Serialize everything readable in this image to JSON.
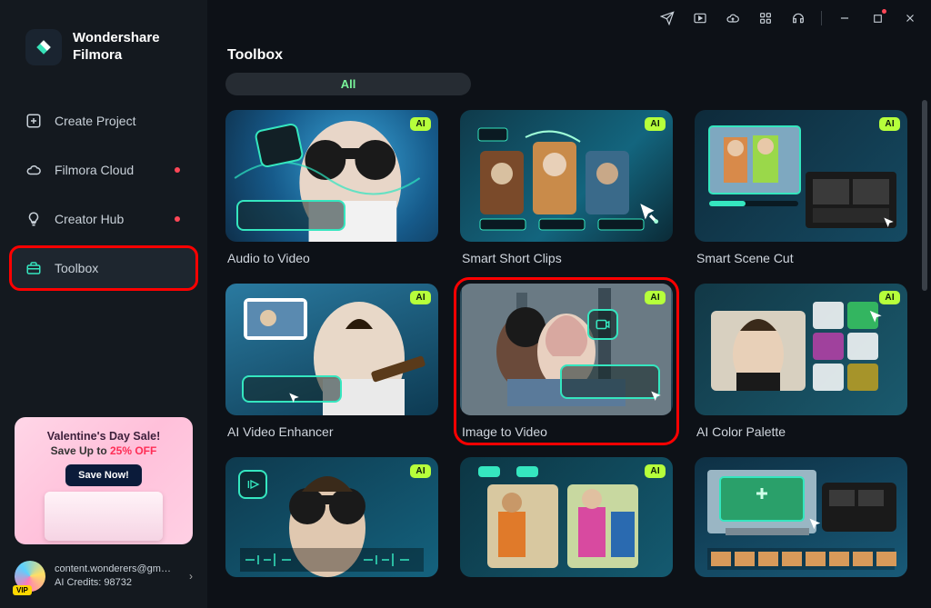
{
  "app": {
    "name_line1": "Wondershare",
    "name_line2": "Filmora"
  },
  "sidebar": {
    "items": [
      {
        "label": "Create Project"
      },
      {
        "label": "Filmora Cloud"
      },
      {
        "label": "Creator Hub"
      },
      {
        "label": "Toolbox"
      }
    ]
  },
  "promo": {
    "title": "Valentine's Day Sale!",
    "subtext_pre": "Save Up to ",
    "subtext_pct": "25% OFF",
    "cta": "Save Now!"
  },
  "user": {
    "email": "content.wonderers@gmail....",
    "credits_label": "AI Credits: 98732",
    "vip": "VIP"
  },
  "main": {
    "heading": "Toolbox",
    "filter": "All",
    "ai_badge": "AI",
    "cards": [
      {
        "label": "Audio to Video"
      },
      {
        "label": "Smart Short Clips"
      },
      {
        "label": "Smart Scene Cut"
      },
      {
        "label": "AI Video Enhancer"
      },
      {
        "label": "Image to Video"
      },
      {
        "label": "AI Color Palette"
      },
      {
        "label": ""
      },
      {
        "label": ""
      },
      {
        "label": ""
      }
    ]
  }
}
